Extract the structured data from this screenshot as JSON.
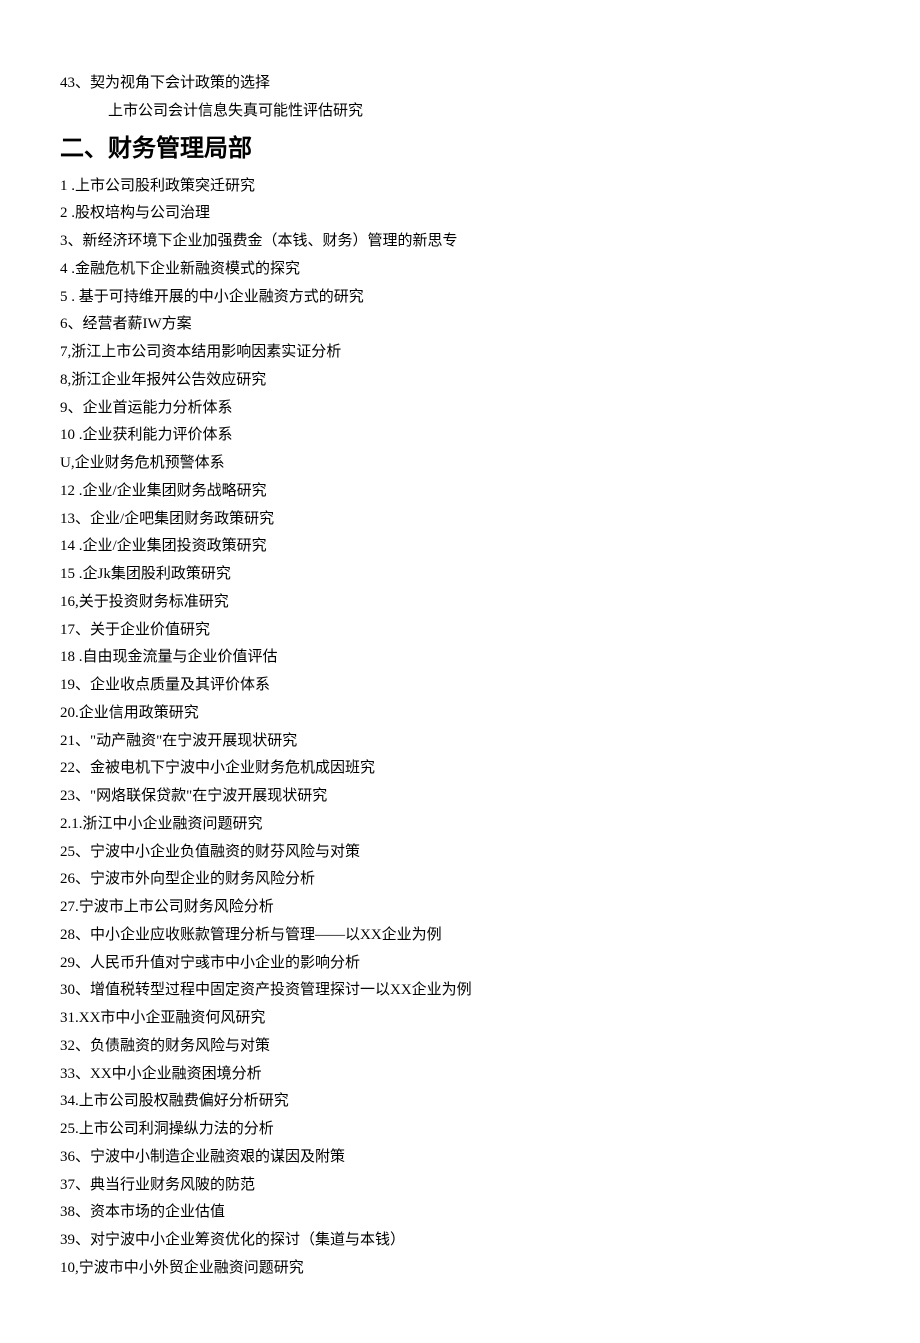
{
  "lines": [
    {
      "text": "43、契为视角下会计政策的选择",
      "type": "item"
    },
    {
      "text": "上市公司会计信息失真可能性评估研究",
      "type": "indent"
    },
    {
      "text": "二、财务管理局部",
      "type": "header"
    },
    {
      "text": "1 .上市公司股利政策突迁研究",
      "type": "item"
    },
    {
      "text": "2 .股权培构与公司治理",
      "type": "item"
    },
    {
      "text": "3、新经济环境下企业加强费金（本钱、财务）管理的新思专",
      "type": "item"
    },
    {
      "text": "4 .金融危机下企业新融资模式的探究",
      "type": "item"
    },
    {
      "text": "5 . 基于可持维开展的中小企业融资方式的研究",
      "type": "item"
    },
    {
      "text": "6、经营者薪IW方案",
      "type": "item"
    },
    {
      "text": "7,浙江上市公司资本结用影响因素实证分析",
      "type": "item"
    },
    {
      "text": "8,浙江企业年报舛公告效应研究",
      "type": "item"
    },
    {
      "text": "9、企业首运能力分析体系",
      "type": "item"
    },
    {
      "text": "10 .企业获利能力评价体系",
      "type": "item"
    },
    {
      "text": "U,企业财务危机预警体系",
      "type": "item"
    },
    {
      "text": "12 .企业/企业集团财务战略研究",
      "type": "item"
    },
    {
      "text": "13、企业/企吧集团财务政策研究",
      "type": "item"
    },
    {
      "text": "14 .企业/企业集团投资政策研究",
      "type": "item"
    },
    {
      "text": "15 .企Jk集团股利政策研究",
      "type": "item"
    },
    {
      "text": "16,关于投资财务标准研究",
      "type": "item"
    },
    {
      "text": "17、关于企业价值研究",
      "type": "item"
    },
    {
      "text": "18 .自由现金流量与企业价值评估",
      "type": "item"
    },
    {
      "text": "19、企业收点质量及其评价体系",
      "type": "item"
    },
    {
      "text": "20.企业信用政策研究",
      "type": "item"
    },
    {
      "text": "21、\"动产融资\"在宁波开展现状研究",
      "type": "item"
    },
    {
      "text": "22、金被电机下宁波中小企业财务危机成因班究",
      "type": "item"
    },
    {
      "text": "23、\"网烙联保贷款\"在宁波开展现状研究",
      "type": "item"
    },
    {
      "text": "2.1.浙江中小企业融资问题研究",
      "type": "item"
    },
    {
      "text": "25、宁波中小企业负值融资的财芬风险与对策",
      "type": "item"
    },
    {
      "text": "26、宁波市外向型企业的财务风险分析",
      "type": "item"
    },
    {
      "text": "27.宁波市上市公司财务风险分析",
      "type": "item"
    },
    {
      "text": "28、中小企业应收账款管理分析与管理——以XX企业为例",
      "type": "item"
    },
    {
      "text": "29、人民币升值对宁彧市中小企业的影响分析",
      "type": "item"
    },
    {
      "text": "30、增值税转型过程中固定资产投资管理探讨一以XX企业为例",
      "type": "item"
    },
    {
      "text": "31.XX市中小企亚融资何风研究",
      "type": "item"
    },
    {
      "text": "32、负债融资的财务风险与对策",
      "type": "item"
    },
    {
      "text": "33、XX中小企业融资困境分析",
      "type": "item"
    },
    {
      "text": "34.上市公司股权融费偏好分析研究",
      "type": "item"
    },
    {
      "text": "25.上市公司利洞操纵力法的分析",
      "type": "item"
    },
    {
      "text": "36、宁波中小制造企业融资艰的谋因及附策",
      "type": "item"
    },
    {
      "text": "37、典当行业财务风陂的防范",
      "type": "item"
    },
    {
      "text": "38、资本市场的企业估值",
      "type": "item"
    },
    {
      "text": "39、对宁波中小企业筹资优化的探讨（集道与本钱）",
      "type": "item"
    },
    {
      "text": "10,宁波市中小外贸企业融资问题研究",
      "type": "item"
    }
  ]
}
